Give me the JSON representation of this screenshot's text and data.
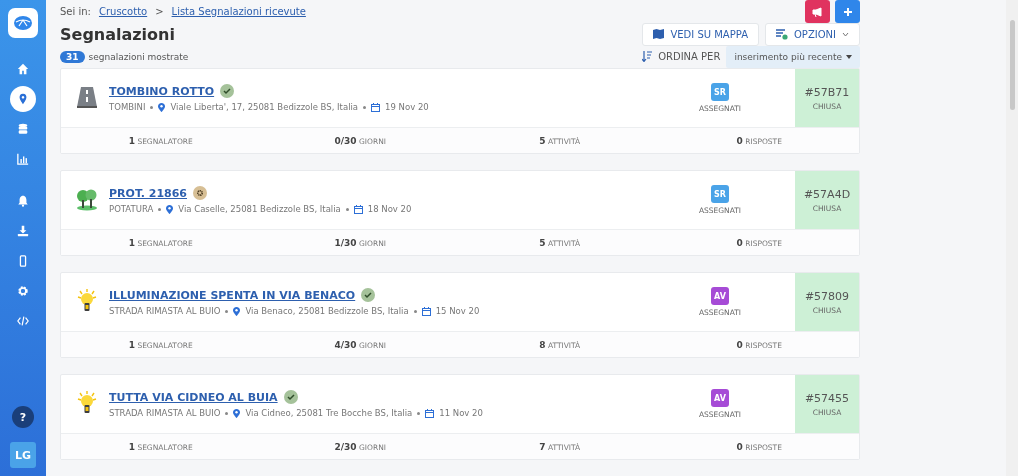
{
  "sidebar": {
    "items": [
      {
        "kind": "home",
        "selected": false
      },
      {
        "kind": "pin",
        "selected": true
      },
      {
        "kind": "database",
        "selected": false
      },
      {
        "kind": "chart",
        "selected": false
      },
      {
        "kind": "bell",
        "selected": false
      },
      {
        "kind": "download",
        "selected": false
      },
      {
        "kind": "mobile",
        "selected": false
      },
      {
        "kind": "gear",
        "selected": false
      },
      {
        "kind": "code",
        "selected": false
      }
    ],
    "help": "?",
    "avatar": "LG"
  },
  "breadcrumb": {
    "prefix": "Sei in:",
    "links": [
      "Cruscotto",
      "Lista Segnalazioni ricevute"
    ],
    "separator": ">"
  },
  "title": "Segnalazioni",
  "count": {
    "value": "31",
    "label": "segnalazioni mostrate"
  },
  "actions": [
    {
      "label": "VEDI SU MAPPA",
      "kind": "map"
    },
    {
      "label": "OPZIONI",
      "kind": "options"
    }
  ],
  "sort": {
    "label": "ORDINA PER",
    "value": "inserimento più recente"
  },
  "reports": [
    {
      "title": "TOMBINO ROTTO",
      "kind": "road",
      "badge": {
        "kind": "check"
      },
      "category": "TOMBINI",
      "address": "Viale Liberta', 17, 25081 Bedizzole BS, Italia",
      "date": "19 Nov 20",
      "assignee": {
        "initials": "SR",
        "color": "#4aa3e8"
      },
      "assigned_label": "ASSEGNATI",
      "id": "#57B71",
      "state": "CHIUSA",
      "stats": [
        {
          "value": "1",
          "label": "SEGNALATORE"
        },
        {
          "value": "0/30",
          "label": "GIORNI"
        },
        {
          "value": "5",
          "label": "ATTIVITÀ"
        },
        {
          "value": "0",
          "label": "RISPOSTE"
        }
      ]
    },
    {
      "title": "PROT. 21866",
      "kind": "trees",
      "badge": {
        "kind": "gear"
      },
      "category": "POTATURA",
      "address": "Via Caselle, 25081 Bedizzole BS, Italia",
      "date": "18 Nov 20",
      "assignee": {
        "initials": "SR",
        "color": "#4aa3e8"
      },
      "assigned_label": "ASSEGNATI",
      "id": "#57A4D",
      "state": "CHIUSA",
      "stats": [
        {
          "value": "1",
          "label": "SEGNALATORE"
        },
        {
          "value": "1/30",
          "label": "GIORNI"
        },
        {
          "value": "5",
          "label": "ATTIVITÀ"
        },
        {
          "value": "0",
          "label": "RISPOSTE"
        }
      ]
    },
    {
      "title": "ILLUMINAZIONE SPENTA IN VIA BENACO",
      "kind": "bulb",
      "badge": {
        "kind": "check"
      },
      "category": "STRADA RIMASTA AL BUIO",
      "address": "Via Benaco, 25081 Bedizzole BS, Italia",
      "date": "15 Nov 20",
      "assignee": {
        "initials": "AV",
        "color": "#a64bd6"
      },
      "assigned_label": "ASSEGNATI",
      "id": "#57809",
      "state": "CHIUSA",
      "stats": [
        {
          "value": "1",
          "label": "SEGNALATORE"
        },
        {
          "value": "4/30",
          "label": "GIORNI"
        },
        {
          "value": "8",
          "label": "ATTIVITÀ"
        },
        {
          "value": "0",
          "label": "RISPOSTE"
        }
      ]
    },
    {
      "title": "TUTTA VIA CIDNEO AL BUIA",
      "kind": "bulb",
      "badge": {
        "kind": "check"
      },
      "category": "STRADA RIMASTA AL BUIO",
      "address": "Via Cidneo, 25081 Tre Bocche BS, Italia",
      "date": "11 Nov 20",
      "assignee": {
        "initials": "AV",
        "color": "#a64bd6"
      },
      "assigned_label": "ASSEGNATI",
      "id": "#57455",
      "state": "CHIUSA",
      "stats": [
        {
          "value": "1",
          "label": "SEGNALATORE"
        },
        {
          "value": "2/30",
          "label": "GIORNI"
        },
        {
          "value": "7",
          "label": "ATTIVITÀ"
        },
        {
          "value": "0",
          "label": "RISPOSTE"
        }
      ]
    }
  ]
}
